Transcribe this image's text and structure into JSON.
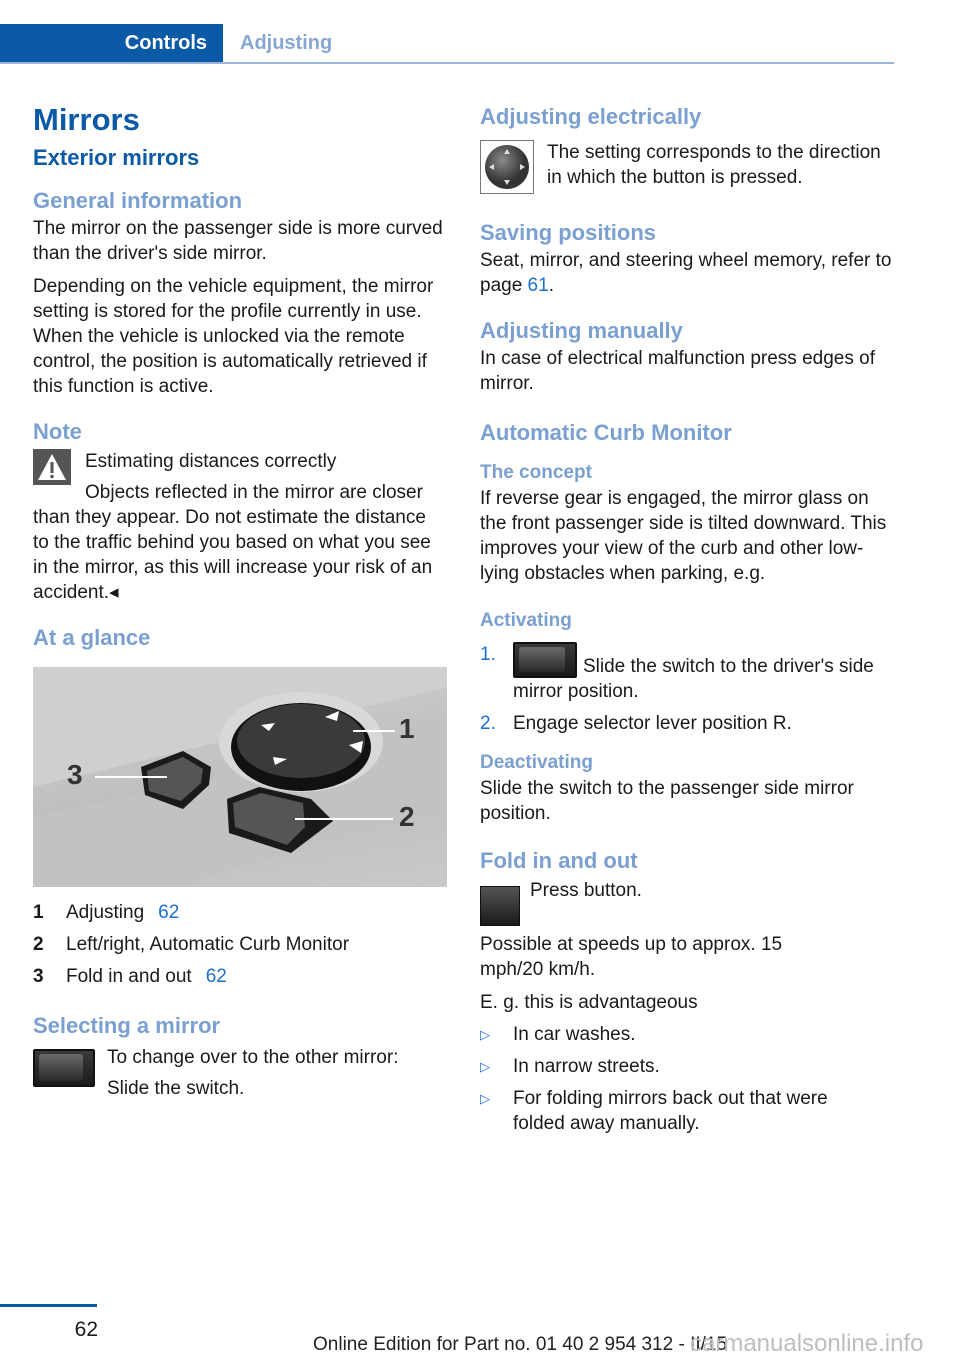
{
  "header": {
    "tab_active": "Controls",
    "tab_inactive": "Adjusting"
  },
  "left": {
    "title": "Mirrors",
    "subtitle": "Exterior mirrors",
    "general": {
      "heading": "General information",
      "p1": "The mirror on the passenger side is more curved than the driver's side mirror.",
      "p2": "Depending on the vehicle equipment, the mirror setting is stored for the profile currently in use. When the vehicle is unlocked via the remote control, the position is automatically retrieved if this function is active."
    },
    "note": {
      "heading": "Note",
      "warning_title": "Estimating distances correctly",
      "warning_text": "Objects reflected in the mirror are closer than they appear. Do not estimate the distance to the traffic behind you based on what you see in the mirror, as this will increase your risk of an accident.◂"
    },
    "glance": {
      "heading": "At a glance",
      "callouts": [
        "1",
        "2",
        "3"
      ],
      "legend": [
        {
          "num": "1",
          "label": "Adjusting",
          "page": "62"
        },
        {
          "num": "2",
          "label": "Left/right, Automatic Curb Monitor",
          "page": ""
        },
        {
          "num": "3",
          "label": "Fold in and out",
          "page": "62"
        }
      ]
    },
    "selecting": {
      "heading": "Selecting a mirror",
      "p1": "To change over to the other mirror:",
      "p2": "Slide the switch."
    }
  },
  "right": {
    "electric": {
      "heading": "Adjusting electrically",
      "text": "The setting corresponds to the direction in which the button is pressed."
    },
    "saving": {
      "heading": "Saving positions",
      "text_before": "Seat, mirror, and steering wheel memory, refer to page ",
      "page": "61",
      "text_after": "."
    },
    "manual": {
      "heading": "Adjusting manually",
      "text": "In case of electrical malfunction press edges of mirror."
    },
    "curb": {
      "heading": "Automatic Curb Monitor",
      "concept_heading": "The concept",
      "concept_text": "If reverse gear is engaged, the mirror glass on the front passenger side is tilted downward. This improves your view of the curb and other low-lying obstacles when parking, e.g.",
      "activating_heading": "Activating",
      "activating_steps": [
        {
          "marker": "1.",
          "text": "Slide the switch to the driver's side mirror position."
        },
        {
          "marker": "2.",
          "text": "Engage selector lever position R."
        }
      ],
      "deactivating_heading": "Deactivating",
      "deactivating_text": "Slide the switch to the passenger side mirror position."
    },
    "fold": {
      "heading": "Fold in and out",
      "press": "Press button.",
      "speed": "Possible at speeds up to approx. 15 mph/20 km/h.",
      "eg": "E. g. this is advantageous",
      "bullets": [
        "In car washes.",
        "In narrow streets.",
        "For folding mirrors back out that were folded away manually."
      ],
      "bullet_marker": "▷"
    }
  },
  "footer": {
    "page_number": "62",
    "edition": "Online Edition for Part no. 01 40 2 954 312 - II/15",
    "watermark": "carmanualsonline.info"
  },
  "colors": {
    "brand_blue": "#0a5aa6",
    "heading_light_blue": "#7a9fd1",
    "link_blue": "#1a6fd0"
  }
}
